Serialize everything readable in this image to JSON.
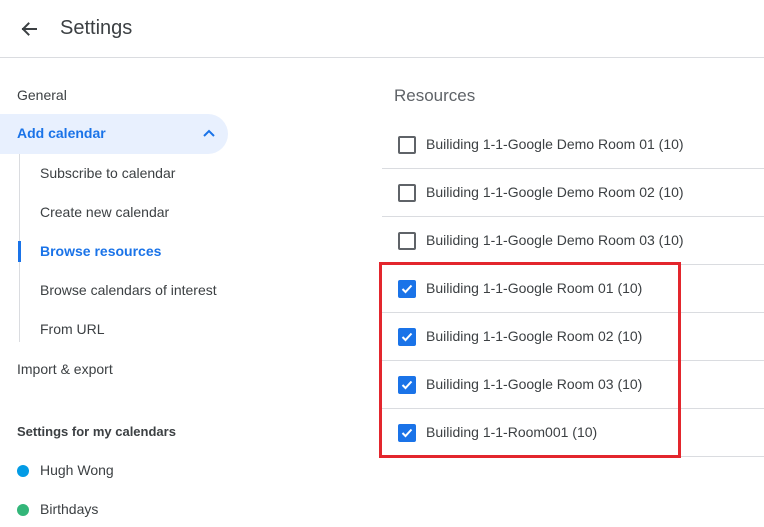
{
  "header": {
    "title": "Settings"
  },
  "sidebar": {
    "general": "General",
    "add_calendar": {
      "label": "Add calendar",
      "sub_items": [
        "Subscribe to calendar",
        "Create new calendar",
        "Browse resources",
        "Browse calendars of interest",
        "From URL"
      ]
    },
    "import_export": "Import & export",
    "my_calendars_heading": "Settings for my calendars",
    "my_calendars": [
      {
        "name": "Hugh Wong",
        "color": "#039be5"
      },
      {
        "name": "Birthdays",
        "color": "#33b679"
      }
    ]
  },
  "resources": {
    "title": "Resources",
    "items": [
      {
        "label": "Builiding 1-1-Google Demo Room 01 (10)",
        "checked": false
      },
      {
        "label": "Builiding 1-1-Google Demo Room 02 (10)",
        "checked": false
      },
      {
        "label": "Builiding 1-1-Google Demo Room 03 (10)",
        "checked": false
      },
      {
        "label": "Builiding 1-1-Google Room 01 (10)",
        "checked": true
      },
      {
        "label": "Builiding 1-1-Google Room 02 (10)",
        "checked": true
      },
      {
        "label": "Builiding 1-1-Google Room 03 (10)",
        "checked": true
      },
      {
        "label": "Builiding 1-1-Room001 (10)",
        "checked": true
      }
    ]
  },
  "colors": {
    "accent": "#1a73e8",
    "highlight": "#e3262d"
  }
}
